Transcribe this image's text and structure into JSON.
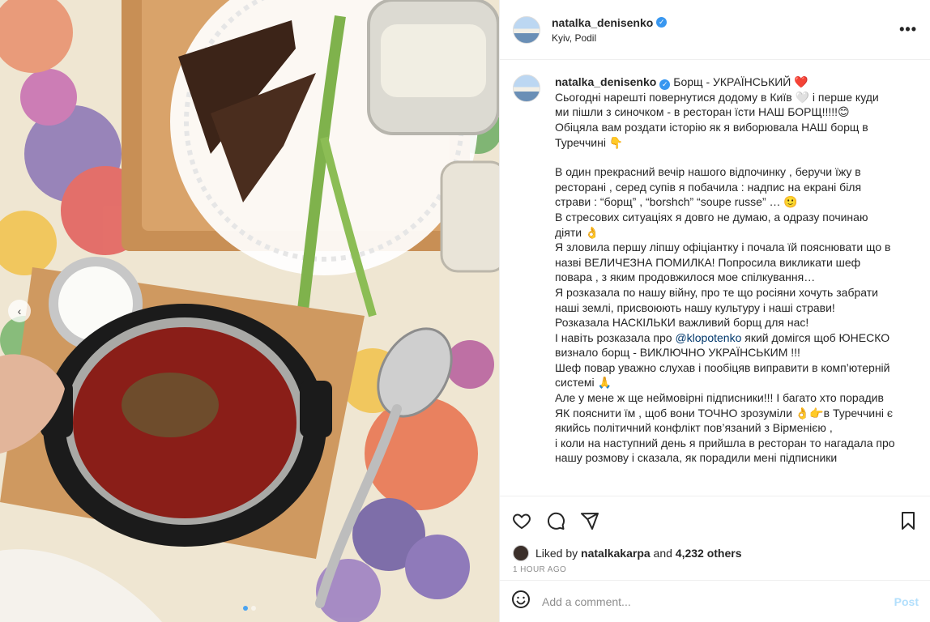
{
  "post": {
    "username": "natalka_denisenko",
    "location": "Kyiv, Podil",
    "verified_mark": "✓",
    "more_label": "•••"
  },
  "caption": {
    "username": "natalka_denisenko",
    "lines": [
      "Борщ - УКРАЇНСЬКИЙ ❤️",
      "Сьогодні нарешті повернутися додому в Київ 🤍 і перше куди ми пішли з синочком - в ресторан їсти НАШ БОРЩ!!!!!😊",
      "Обіцяла вам роздати історію як я виборювала НАШ борщ в Туреччині 👇",
      "",
      "В один прекрасний вечір нашого відпочинку , беручи їжу в ресторані , серед супів я побачила : надпис на екрані біля страви : “борщ” , “borshch” “soupe russe” … 🙂",
      "В стресових ситуаціях я довго не думаю, а одразу починаю діяти 👌",
      "Я зловила першу ліпшу офіціантку і почала їй пояснювати що в назві ВЕЛИЧЕЗНА ПОМИЛКА! Попросила викликати шеф повара , з яким продовжилося мое спілкування…",
      "Я розказала по нашу війну, про те що росіяни хочуть забрати наші землі, присвоюють нашу культуру і наші страви!",
      "Розказала НАСКІЛЬКИ важливий борщ для нас!",
      "Шеф повар уважно слухав і пообіцяв виправити в комп’ютерній системі 🙏",
      "Але у мене ж ще неймовірні підписники!!! І багато хто порадив ЯК пояснити їм , щоб вони ТОЧНО зрозуміли 👌👉в Туреччині є якийсь політичний конфлікт пов’язаний з Вірменією ,",
      "і коли на наступний день я прийшла в ресторан то нагадала про нашу розмову і сказала, як порадили мені підписники"
    ],
    "mention_line_prefix": "І навіть розказала про ",
    "mention": "@klopotenko",
    "mention_line_suffix": " який домігся щоб ЮНЕСКО визнало борщ - ВИКЛЮЧНО УКРАЇНСЬКИМ !!!"
  },
  "likes": {
    "liked_by_prefix": "Liked by",
    "liker": "natalkakarpa",
    "and_text": "and",
    "others": "4,232 others"
  },
  "time_ago": "1 HOUR AGO",
  "comment": {
    "placeholder": "Add a comment...",
    "post_label": "Post"
  },
  "icons": {
    "like": "heart-icon",
    "comment": "comment-icon",
    "share": "share-icon",
    "save": "bookmark-icon",
    "emoji": "emoji-icon"
  },
  "colors": {
    "verified": "#3897f0",
    "post_button": "#b2dffc",
    "mention": "#00376b"
  }
}
